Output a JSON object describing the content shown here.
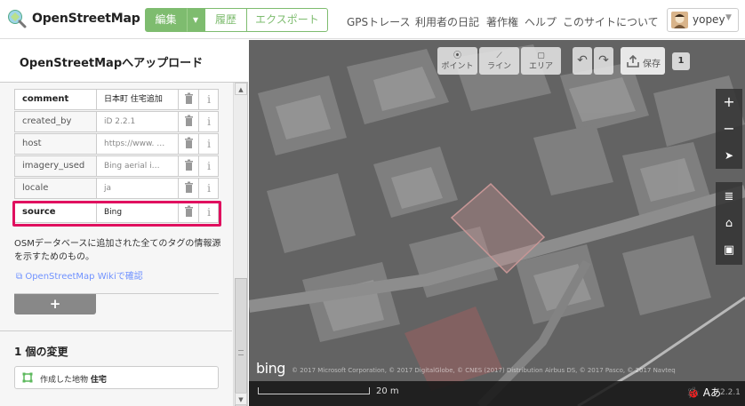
{
  "header": {
    "brand": "OpenStreetMap",
    "edit_label": "編集",
    "edit_dropdown": "▾",
    "history_label": "履歴",
    "export_label": "エクスポート",
    "nav_links": [
      "GPSトレース",
      "利用者の日記",
      "著作権",
      "ヘルプ",
      "このサイトについて"
    ],
    "user_name": "yopey",
    "user_caret": "▼"
  },
  "sidebar": {
    "title": "OpenStreetMapへアップロード",
    "tags": [
      {
        "key": "comment",
        "value": "日本町 住宅追加"
      },
      {
        "key": "created_by",
        "value": "iD 2.2.1"
      },
      {
        "key": "host",
        "value": "https://www. …"
      },
      {
        "key": "imagery_used",
        "value": "Bing aerial i…"
      },
      {
        "key": "locale",
        "value": "ja"
      },
      {
        "key": "source",
        "value": "Bing"
      }
    ],
    "info_glyph": "i",
    "tag_description": "OSMデータベースに追加された全てのタグの情報源を示すためのもの。",
    "wiki_link": "OpenStreetMap Wikiで確認",
    "add_tag_label": "+",
    "changes_title": "1 個の変更",
    "change_item_prefix": "作成した地物",
    "change_item_name": "住宅"
  },
  "scrollbar": {
    "up": "▲",
    "down": "▼"
  },
  "map": {
    "toolbar": [
      {
        "icon": "point-icon",
        "label": "ポイント"
      },
      {
        "icon": "line-icon",
        "label": "ライン"
      },
      {
        "icon": "area-icon",
        "label": "エリア"
      }
    ],
    "undo_icon": "undo-icon",
    "redo_icon": "redo-icon",
    "save_label": "保存",
    "save_count": "1",
    "controls": [
      "+",
      "−",
      "➤"
    ],
    "side_controls": [
      "layers-icon",
      "map-data-icon",
      "help-icon"
    ],
    "bing_logo": "bing",
    "attribution": "© 2017 Microsoft Corporation, © 2017 DigitalGlobe, © CNES (2017) Distribution Airbus DS, © 2017 Pasco, © 2017 Navteq",
    "scale_label": "20 m",
    "version": "2.2.1"
  },
  "colors": {
    "brand_green": "#7ebc6f",
    "highlight": "#e0105f",
    "link": "#7092ff"
  }
}
